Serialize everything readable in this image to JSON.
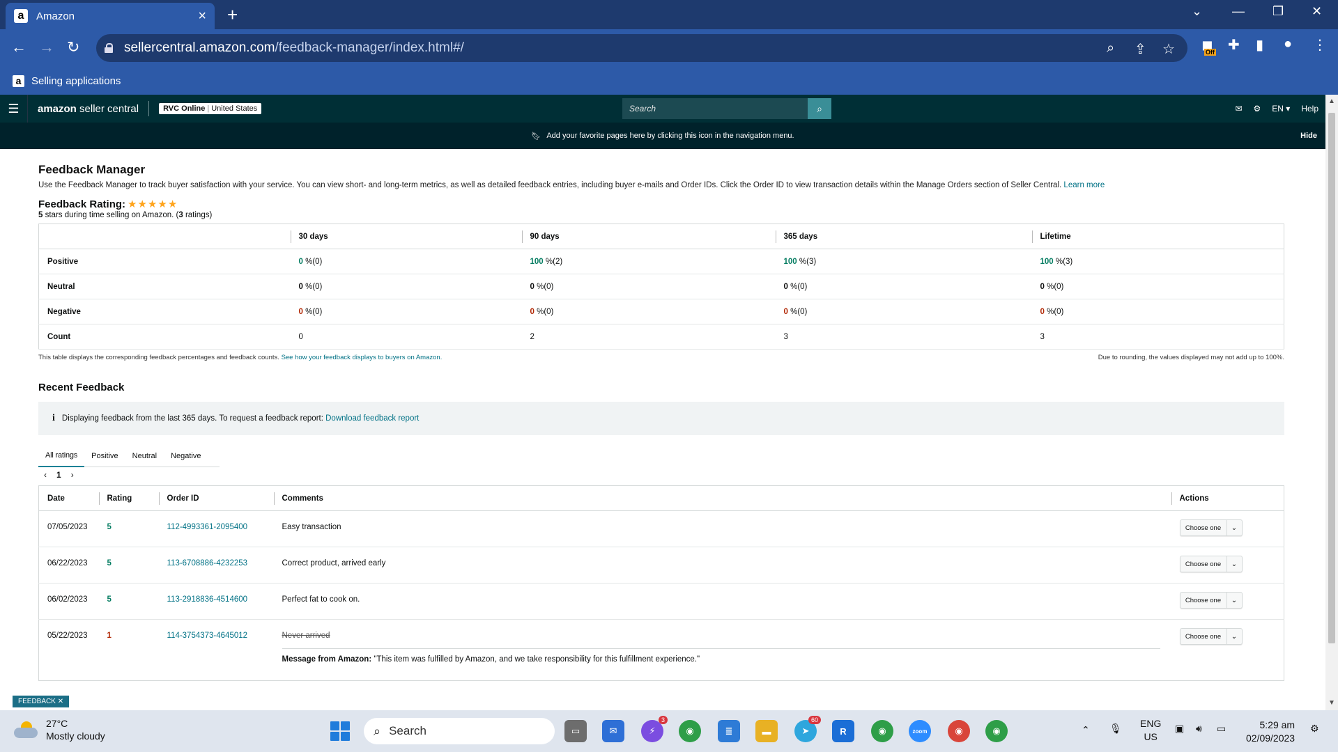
{
  "browser": {
    "tab_title": "Amazon",
    "url_host": "sellercentral.amazon.com",
    "url_path": "/feedback-manager/index.html#/",
    "bookmark_label": "Selling applications",
    "extension_badge": "Off"
  },
  "header": {
    "logo_bold": "amazon",
    "logo_rest": " seller central",
    "store_name": "RVC Online",
    "store_region": "United States",
    "search_placeholder": "Search",
    "language": "EN",
    "help": "Help"
  },
  "favorites_bar": {
    "text": "Add your favorite pages here by clicking this icon in the navigation menu.",
    "hide": "Hide"
  },
  "page": {
    "title": "Feedback Manager",
    "intro": "Use the Feedback Manager to track buyer satisfaction with your service. You can view short- and long-term metrics, as well as detailed feedback entries, including buyer e-mails and Order IDs. Click the Order ID to view transaction details within the Manage Orders section of Seller Central.",
    "learn_more": "Learn more",
    "rating_label": "Feedback Rating:",
    "stars": "★★★★★",
    "rating_stars_value": "5",
    "rating_mid": " stars during time selling on Amazon. (",
    "rating_count": "3",
    "rating_end": " ratings)"
  },
  "metrics": {
    "columns": [
      "30 days",
      "90 days",
      "365 days",
      "Lifetime"
    ],
    "rows": {
      "positive": {
        "label": "Positive",
        "values": [
          "0",
          "100",
          "100",
          "100"
        ],
        "counts": [
          "%(0)",
          "%(2)",
          "%(3)",
          "%(3)"
        ]
      },
      "neutral": {
        "label": "Neutral",
        "values": [
          "0",
          "0",
          "0",
          "0"
        ],
        "counts": [
          "%(0)",
          "%(0)",
          "%(0)",
          "%(0)"
        ]
      },
      "negative": {
        "label": "Negative",
        "values": [
          "0",
          "0",
          "0",
          "0"
        ],
        "counts": [
          "%(0)",
          "%(0)",
          "%(0)",
          "%(0)"
        ]
      },
      "count": {
        "label": "Count",
        "values": [
          "0",
          "2",
          "3",
          "3"
        ]
      }
    },
    "note_left": "This table displays the corresponding feedback percentages and feedback counts.",
    "note_link": "See how your feedback displays to buyers on Amazon.",
    "note_right": "Due to rounding, the values displayed may not add up to 100%."
  },
  "recent": {
    "title": "Recent Feedback",
    "info_text": "Displaying feedback from the last 365 days. To request a feedback report:",
    "info_link": "Download feedback report",
    "tabs": [
      "All ratings",
      "Positive",
      "Neutral",
      "Negative"
    ],
    "page_number": "1",
    "columns": [
      "Date",
      "Rating",
      "Order ID",
      "Comments",
      "Actions"
    ],
    "rows": [
      {
        "date": "07/05/2023",
        "rating": "5",
        "order_id": "112-4993361-2095400",
        "comment": "Easy transaction",
        "action": "Choose one"
      },
      {
        "date": "06/22/2023",
        "rating": "5",
        "order_id": "113-6708886-4232253",
        "comment": "Correct product, arrived early",
        "action": "Choose one"
      },
      {
        "date": "06/02/2023",
        "rating": "5",
        "order_id": "113-2918836-4514600",
        "comment": "Perfect fat to cook on.",
        "action": "Choose one"
      },
      {
        "date": "05/22/2023",
        "rating": "1",
        "order_id": "114-3754373-4645012",
        "comment": "Never arrived",
        "action": "Choose one",
        "message_label": "Message from Amazon:",
        "message": "\"This item was fulfilled by Amazon, and we take responsibility for this fulfillment experience.\""
      }
    ]
  },
  "feedback_tag": "FEEDBACK",
  "taskbar": {
    "temperature": "27°C",
    "weather": "Mostly cloudy",
    "search": "Search",
    "messenger_badge": "3",
    "telegram_badge": "60",
    "lang_top": "ENG",
    "lang_bottom": "US",
    "time": "5:29 am",
    "date": "02/09/2023"
  },
  "colors": {
    "header_bg": "#002f36",
    "link": "#007185",
    "positive": "#067d62",
    "negative": "#b12704",
    "browser_chrome": "#2d5aa8"
  }
}
